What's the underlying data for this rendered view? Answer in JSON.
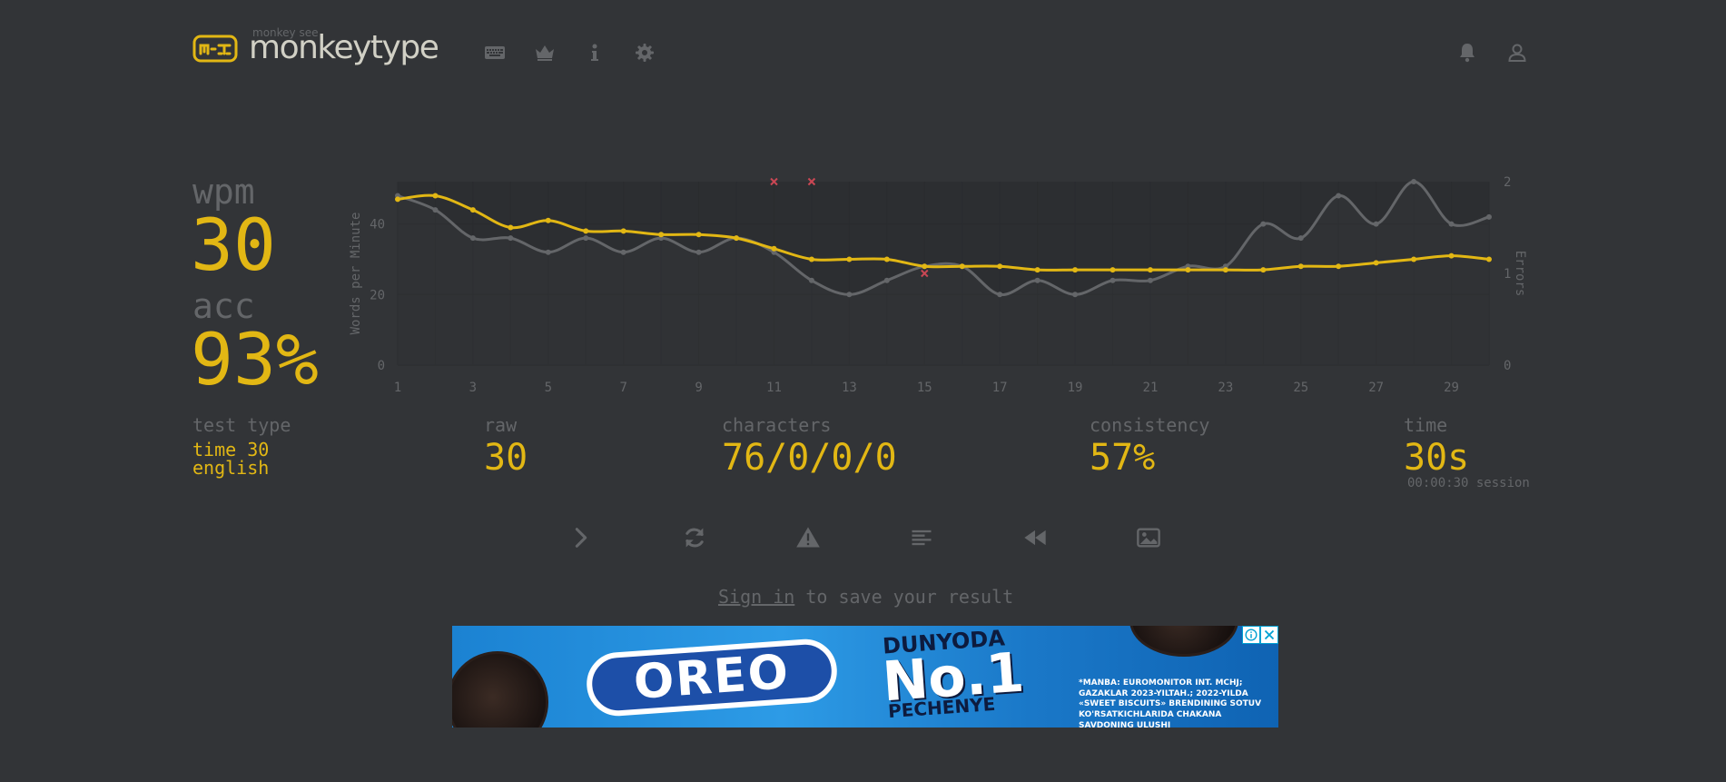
{
  "header": {
    "logo_top": "monkey see",
    "logo_text": "monkeytype",
    "nav_icons": [
      "keyboard-icon",
      "crown-icon",
      "info-icon",
      "gear-icon"
    ],
    "account_icons": [
      "bell-icon",
      "user-icon"
    ]
  },
  "stats": {
    "wpm_label": "wpm",
    "wpm_value": "30",
    "acc_label": "acc",
    "acc_value": "93%",
    "test_type_label": "test type",
    "test_type_mode": "time 30",
    "test_type_language": "english",
    "raw_label": "raw",
    "raw_value": "30",
    "characters_label": "characters",
    "characters_value": "76/0/0/0",
    "consistency_label": "consistency",
    "consistency_value": "57%",
    "time_label": "time",
    "time_value": "30s",
    "session_text": "00:00:30 session"
  },
  "chart_data": {
    "type": "line",
    "ylabel": "Words per Minute",
    "y2label": "Errors",
    "x": [
      1,
      2,
      3,
      4,
      5,
      6,
      7,
      8,
      9,
      10,
      11,
      12,
      13,
      14,
      15,
      16,
      17,
      18,
      19,
      20,
      21,
      22,
      23,
      24,
      25,
      26,
      27,
      28,
      29,
      30
    ],
    "x_ticks": [
      1,
      3,
      5,
      7,
      9,
      11,
      13,
      15,
      17,
      19,
      21,
      23,
      25,
      27,
      29
    ],
    "y_ticks": [
      0,
      20,
      40
    ],
    "ylim": [
      0,
      52
    ],
    "y2_ticks": [
      0,
      1,
      2
    ],
    "y2lim": [
      0,
      2
    ],
    "series": [
      {
        "role": "wpm",
        "color": "#e2b714",
        "values": [
          47,
          48,
          44,
          39,
          41,
          38,
          38,
          37,
          37,
          36,
          33,
          30,
          30,
          30,
          28,
          28,
          28,
          27,
          27,
          27,
          27,
          27,
          27,
          27,
          28,
          28,
          29,
          30,
          31,
          30
        ]
      },
      {
        "role": "raw",
        "color": "#646669",
        "values": [
          48,
          44,
          36,
          36,
          32,
          36,
          32,
          36,
          32,
          36,
          32,
          24,
          20,
          24,
          28,
          28,
          20,
          24,
          20,
          24,
          24,
          28,
          28,
          40,
          36,
          48,
          40,
          52,
          40,
          42
        ]
      }
    ],
    "errors": [
      {
        "x": 11,
        "count": 2
      },
      {
        "x": 12,
        "count": 2
      },
      {
        "x": 15,
        "count": 1
      }
    ],
    "error_color": "#ca4754",
    "grid": true
  },
  "actions": [
    {
      "name": "next-test-button",
      "icon": "chevron-right-icon"
    },
    {
      "name": "restart-test-button",
      "icon": "refresh-icon"
    },
    {
      "name": "practice-words-button",
      "icon": "warning-icon"
    },
    {
      "name": "show-words-history-button",
      "icon": "align-left-icon"
    },
    {
      "name": "watch-replay-button",
      "icon": "rewind-icon"
    },
    {
      "name": "save-screenshot-button",
      "icon": "image-icon"
    }
  ],
  "signin": {
    "link_text": "Sign in",
    "rest_text": " to save your result"
  },
  "ad": {
    "brand": "OREO",
    "slogan_1": "DUNYODA",
    "slogan_2": "No.1",
    "slogan_3": "PECHENYE",
    "fine_print": "*MANBA: EUROMONITOR INT. MCHJ; GAZAKLAR 2023-YILTAH.; 2022-YILDA «SWEET BISCUITS» BRENDINING SOTUV KO'RSATKICHLARIDA CHAKANA SAVDONING ULUSHI"
  }
}
